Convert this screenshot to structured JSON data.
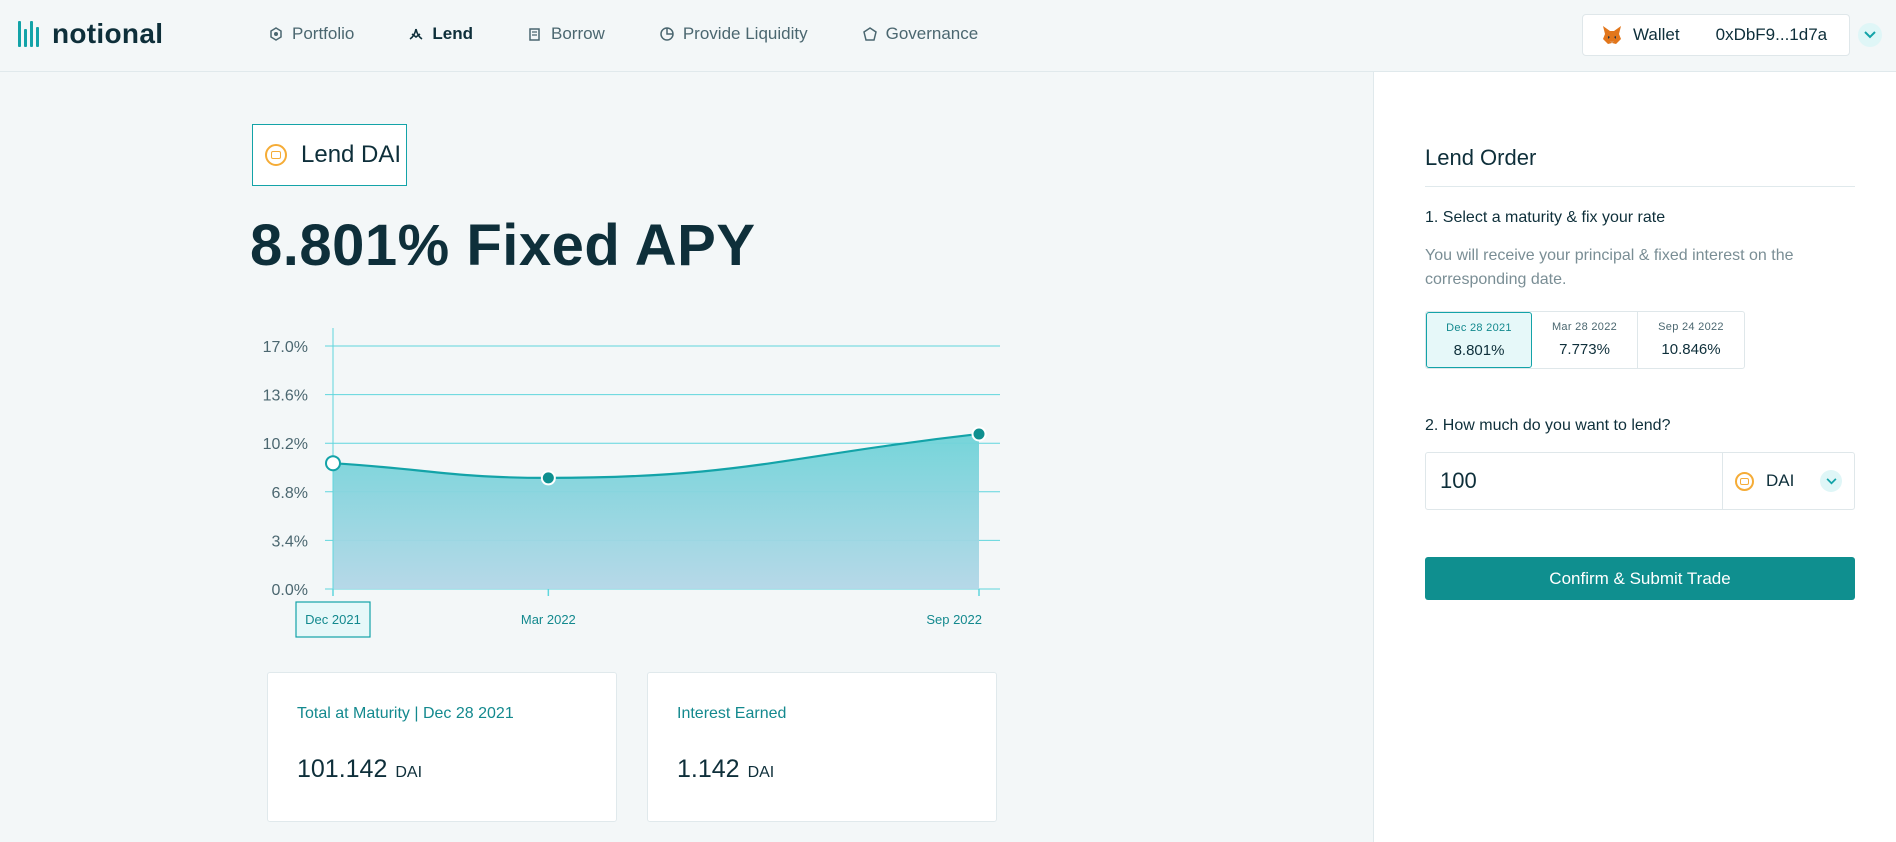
{
  "header": {
    "logo_text": "notional",
    "nav": [
      {
        "label": "Portfolio",
        "icon": "portfolio-icon"
      },
      {
        "label": "Lend",
        "icon": "lend-icon",
        "active": true
      },
      {
        "label": "Borrow",
        "icon": "borrow-icon"
      },
      {
        "label": "Provide Liquidity",
        "icon": "liquidity-icon"
      },
      {
        "label": "Governance",
        "icon": "governance-icon"
      }
    ],
    "wallet": {
      "label": "Wallet",
      "address": "0xDbF9...1d7a",
      "icon": "metamask-fox-icon"
    }
  },
  "main": {
    "badge_label": "Lend DAI",
    "apy_headline": "8.801% Fixed APY",
    "chart_data": {
      "type": "area",
      "x": [
        "Dec 2021",
        "Mar 2022",
        "Sep 2022"
      ],
      "values": [
        8.801,
        7.773,
        10.846
      ],
      "y_ticks": [
        "17.0%",
        "13.6%",
        "10.2%",
        "6.8%",
        "3.4%",
        "0.0%"
      ],
      "ylim": [
        0,
        17.0
      ],
      "selected": "Dec 2021",
      "grid": true,
      "colors": {
        "line": "#13a3a8",
        "fill_top": "#6fd3d8",
        "fill_bottom": "#b3d7e7",
        "marker": "#0f8f8f"
      }
    },
    "cards": [
      {
        "title": "Total at Maturity | Dec 28 2021",
        "value": "101.142",
        "unit": "DAI"
      },
      {
        "title": "Interest Earned",
        "value": "1.142",
        "unit": "DAI"
      }
    ]
  },
  "order": {
    "title": "Lend Order",
    "step1_label": "1. Select a maturity & fix your rate",
    "step1_desc": "You will receive your principal & fixed interest on the corresponding date.",
    "maturities": [
      {
        "date": "Dec 28 2021",
        "rate": "8.801%",
        "selected": true
      },
      {
        "date": "Mar 28 2022",
        "rate": "7.773%"
      },
      {
        "date": "Sep 24 2022",
        "rate": "10.846%"
      }
    ],
    "step2_label": "2. How much do you want to lend?",
    "amount": "100",
    "currency": "DAI",
    "confirm_label": "Confirm & Submit Trade"
  },
  "colors": {
    "accent": "#13a3a8",
    "button": "#0f8f8f",
    "dai": "#f5ac37",
    "text_dark": "#0e2f3a"
  }
}
